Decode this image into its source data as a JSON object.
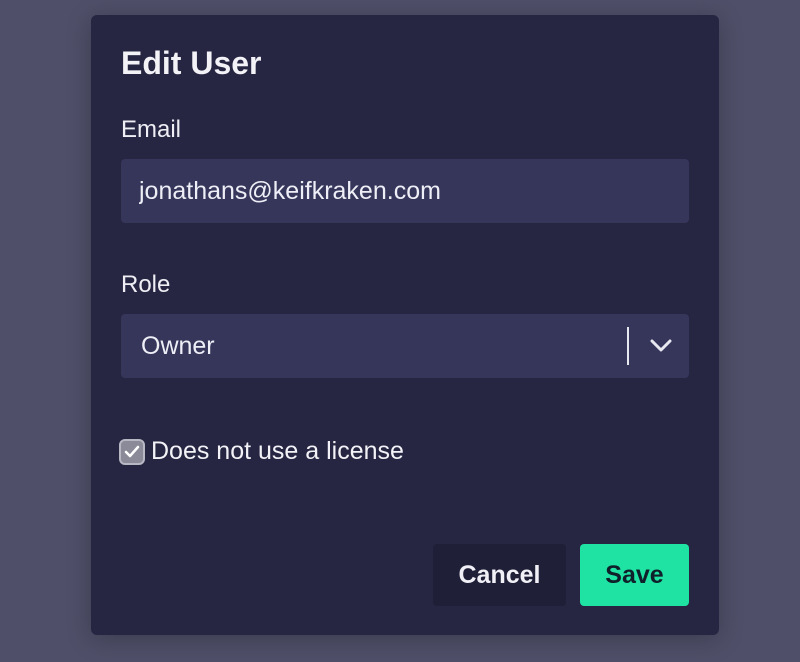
{
  "modal": {
    "title": "Edit User",
    "email_label": "Email",
    "email_value": "jonathans@keifkraken.com",
    "role_label": "Role",
    "role_selected": "Owner",
    "license_checkbox_label": "Does not use a license",
    "license_checked": true,
    "cancel_label": "Cancel",
    "save_label": "Save"
  },
  "icons": {
    "dropdown": "chevron-down-icon",
    "check": "checkmark-icon"
  },
  "colors": {
    "backdrop": "#4f4f69",
    "modal_bg": "#262642",
    "field_bg": "#35365a",
    "save_accent": "#1ee3a3",
    "cancel_bg": "#1f1f38"
  }
}
